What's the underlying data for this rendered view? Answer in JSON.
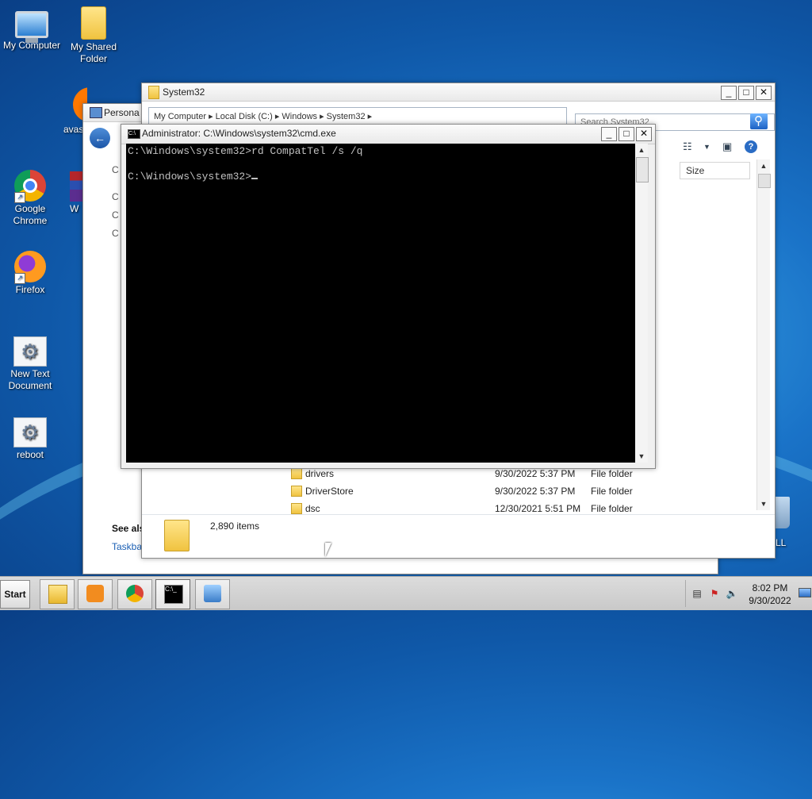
{
  "desktop": {
    "icons": [
      {
        "label": "My Computer",
        "icon": "computer-icon"
      },
      {
        "label": "My Shared Folder",
        "icon": "folder-icon"
      },
      {
        "label": "avas",
        "icon": "avast-icon"
      },
      {
        "label": "Google Chrome",
        "icon": "chrome-icon"
      },
      {
        "label": "W",
        "icon": "winrar-icon"
      },
      {
        "label": "Firefox",
        "icon": "firefox-icon"
      },
      {
        "label": "New Text Document",
        "icon": "settings-doc-icon"
      },
      {
        "label": "reboot",
        "icon": "settings-doc-icon"
      },
      {
        "label": "LL",
        "icon": "recycle-bin-icon"
      }
    ]
  },
  "personal_window": {
    "title": "Persona",
    "left_items": [
      "C",
      "C",
      "C"
    ],
    "see_also": "See als",
    "taskbar_link": "Taskba"
  },
  "explorer": {
    "title": "System32",
    "address": "My Computer ▸ Local Disk (C:) ▸ Windows ▸ System32 ▸",
    "search_placeholder": "Search System32",
    "column_size": "Size",
    "files": [
      {
        "name": "drivers",
        "date": "9/30/2022 5:37 PM",
        "type": "File folder"
      },
      {
        "name": "DriverStore",
        "date": "9/30/2022 5:37 PM",
        "type": "File folder"
      },
      {
        "name": "dsc",
        "date": "12/30/2021 5:51 PM",
        "type": "File folder"
      }
    ],
    "item_count": "2,890 items"
  },
  "cmd": {
    "title": "Administrator: C:\\Windows\\system32\\cmd.exe",
    "line1": "C:\\Windows\\system32>rd CompatTel /s /q",
    "line2": "",
    "line3": "C:\\Windows\\system32>"
  },
  "taskbar": {
    "start_label": "Start",
    "time": "8:02 PM",
    "date": "9/30/2022",
    "buttons": [
      "file-explorer-icon",
      "media-player-icon",
      "chrome-icon",
      "cmd-icon",
      "control-panel-icon"
    ]
  }
}
